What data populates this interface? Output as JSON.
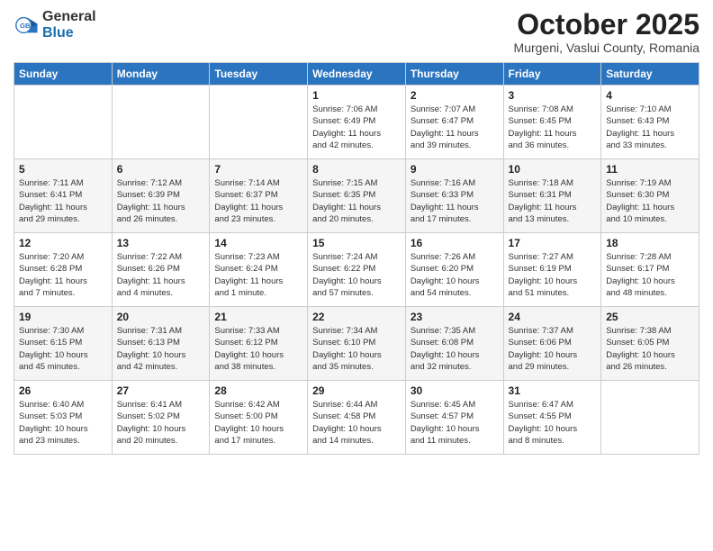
{
  "logo": {
    "general": "General",
    "blue": "Blue"
  },
  "header": {
    "month": "October 2025",
    "location": "Murgeni, Vaslui County, Romania"
  },
  "weekdays": [
    "Sunday",
    "Monday",
    "Tuesday",
    "Wednesday",
    "Thursday",
    "Friday",
    "Saturday"
  ],
  "weeks": [
    [
      {
        "day": "",
        "info": ""
      },
      {
        "day": "",
        "info": ""
      },
      {
        "day": "",
        "info": ""
      },
      {
        "day": "1",
        "info": "Sunrise: 7:06 AM\nSunset: 6:49 PM\nDaylight: 11 hours\nand 42 minutes."
      },
      {
        "day": "2",
        "info": "Sunrise: 7:07 AM\nSunset: 6:47 PM\nDaylight: 11 hours\nand 39 minutes."
      },
      {
        "day": "3",
        "info": "Sunrise: 7:08 AM\nSunset: 6:45 PM\nDaylight: 11 hours\nand 36 minutes."
      },
      {
        "day": "4",
        "info": "Sunrise: 7:10 AM\nSunset: 6:43 PM\nDaylight: 11 hours\nand 33 minutes."
      }
    ],
    [
      {
        "day": "5",
        "info": "Sunrise: 7:11 AM\nSunset: 6:41 PM\nDaylight: 11 hours\nand 29 minutes."
      },
      {
        "day": "6",
        "info": "Sunrise: 7:12 AM\nSunset: 6:39 PM\nDaylight: 11 hours\nand 26 minutes."
      },
      {
        "day": "7",
        "info": "Sunrise: 7:14 AM\nSunset: 6:37 PM\nDaylight: 11 hours\nand 23 minutes."
      },
      {
        "day": "8",
        "info": "Sunrise: 7:15 AM\nSunset: 6:35 PM\nDaylight: 11 hours\nand 20 minutes."
      },
      {
        "day": "9",
        "info": "Sunrise: 7:16 AM\nSunset: 6:33 PM\nDaylight: 11 hours\nand 17 minutes."
      },
      {
        "day": "10",
        "info": "Sunrise: 7:18 AM\nSunset: 6:31 PM\nDaylight: 11 hours\nand 13 minutes."
      },
      {
        "day": "11",
        "info": "Sunrise: 7:19 AM\nSunset: 6:30 PM\nDaylight: 11 hours\nand 10 minutes."
      }
    ],
    [
      {
        "day": "12",
        "info": "Sunrise: 7:20 AM\nSunset: 6:28 PM\nDaylight: 11 hours\nand 7 minutes."
      },
      {
        "day": "13",
        "info": "Sunrise: 7:22 AM\nSunset: 6:26 PM\nDaylight: 11 hours\nand 4 minutes."
      },
      {
        "day": "14",
        "info": "Sunrise: 7:23 AM\nSunset: 6:24 PM\nDaylight: 11 hours\nand 1 minute."
      },
      {
        "day": "15",
        "info": "Sunrise: 7:24 AM\nSunset: 6:22 PM\nDaylight: 10 hours\nand 57 minutes."
      },
      {
        "day": "16",
        "info": "Sunrise: 7:26 AM\nSunset: 6:20 PM\nDaylight: 10 hours\nand 54 minutes."
      },
      {
        "day": "17",
        "info": "Sunrise: 7:27 AM\nSunset: 6:19 PM\nDaylight: 10 hours\nand 51 minutes."
      },
      {
        "day": "18",
        "info": "Sunrise: 7:28 AM\nSunset: 6:17 PM\nDaylight: 10 hours\nand 48 minutes."
      }
    ],
    [
      {
        "day": "19",
        "info": "Sunrise: 7:30 AM\nSunset: 6:15 PM\nDaylight: 10 hours\nand 45 minutes."
      },
      {
        "day": "20",
        "info": "Sunrise: 7:31 AM\nSunset: 6:13 PM\nDaylight: 10 hours\nand 42 minutes."
      },
      {
        "day": "21",
        "info": "Sunrise: 7:33 AM\nSunset: 6:12 PM\nDaylight: 10 hours\nand 38 minutes."
      },
      {
        "day": "22",
        "info": "Sunrise: 7:34 AM\nSunset: 6:10 PM\nDaylight: 10 hours\nand 35 minutes."
      },
      {
        "day": "23",
        "info": "Sunrise: 7:35 AM\nSunset: 6:08 PM\nDaylight: 10 hours\nand 32 minutes."
      },
      {
        "day": "24",
        "info": "Sunrise: 7:37 AM\nSunset: 6:06 PM\nDaylight: 10 hours\nand 29 minutes."
      },
      {
        "day": "25",
        "info": "Sunrise: 7:38 AM\nSunset: 6:05 PM\nDaylight: 10 hours\nand 26 minutes."
      }
    ],
    [
      {
        "day": "26",
        "info": "Sunrise: 6:40 AM\nSunset: 5:03 PM\nDaylight: 10 hours\nand 23 minutes."
      },
      {
        "day": "27",
        "info": "Sunrise: 6:41 AM\nSunset: 5:02 PM\nDaylight: 10 hours\nand 20 minutes."
      },
      {
        "day": "28",
        "info": "Sunrise: 6:42 AM\nSunset: 5:00 PM\nDaylight: 10 hours\nand 17 minutes."
      },
      {
        "day": "29",
        "info": "Sunrise: 6:44 AM\nSunset: 4:58 PM\nDaylight: 10 hours\nand 14 minutes."
      },
      {
        "day": "30",
        "info": "Sunrise: 6:45 AM\nSunset: 4:57 PM\nDaylight: 10 hours\nand 11 minutes."
      },
      {
        "day": "31",
        "info": "Sunrise: 6:47 AM\nSunset: 4:55 PM\nDaylight: 10 hours\nand 8 minutes."
      },
      {
        "day": "",
        "info": ""
      }
    ]
  ]
}
